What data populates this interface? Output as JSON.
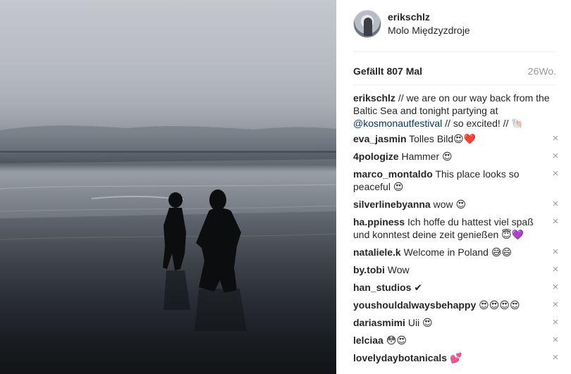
{
  "post": {
    "username": "erikschlz",
    "location": "Molo Międzyzdroje",
    "likes": "Gefällt 807 Mal",
    "age": "26Wo.",
    "caption": {
      "user": "erikschlz",
      "text_1": " // we are on our way back from the Baltic Sea and tonight partying at ",
      "mention": "@kosmonautfestival",
      "text_2": " // so excited! // 🐚"
    }
  },
  "comments": [
    {
      "user": "eva_jasmin",
      "text": " Tolles Bild😍❤️"
    },
    {
      "user": "4pologize",
      "text": " Hammer 😍"
    },
    {
      "user": "marco_montaldo",
      "text": " This place looks so peaceful 😍"
    },
    {
      "user": "silverlinebyanna",
      "text": " wow 😍"
    },
    {
      "user": "ha.ppiness",
      "text": " Ich hoffe du hattest viel spaß und konntest deine zeit genießen 😇💜"
    },
    {
      "user": "nataliele.k",
      "text": " Welcome in Poland 😅😄"
    },
    {
      "user": "by.tobi",
      "text": " Wow"
    },
    {
      "user": "han_studios",
      "text": " ✔"
    },
    {
      "user": "youshouldalwaysbehappy",
      "text": " 😍😍😍😍"
    },
    {
      "user": "dariasmimi",
      "text": " Uii 😍"
    },
    {
      "user": "lelciaa",
      "text": " 😳😍"
    },
    {
      "user": "lovelydaybotanicals",
      "text": " 💕"
    }
  ],
  "icons": {
    "remove": "×"
  }
}
